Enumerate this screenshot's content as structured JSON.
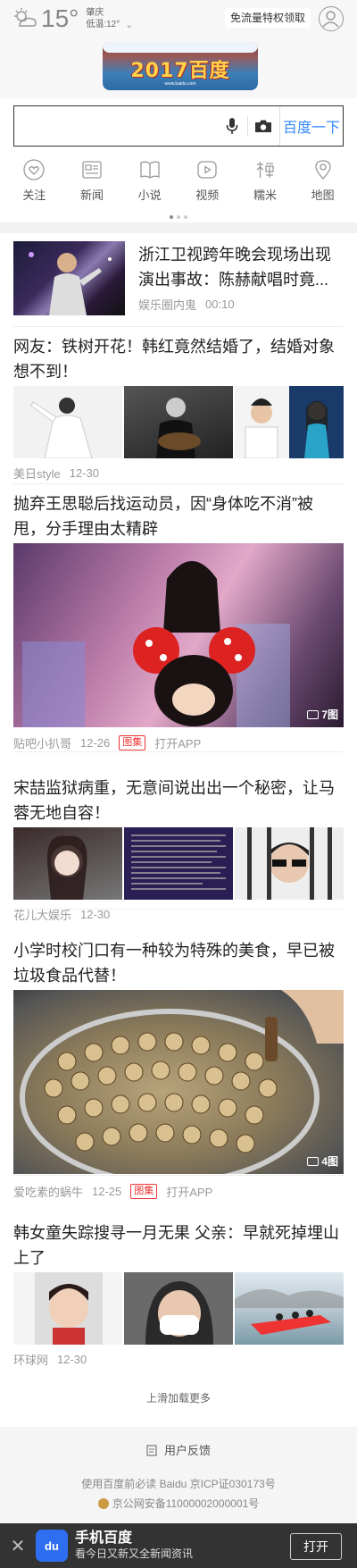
{
  "header": {
    "temperature": "15°",
    "city": "肇庆",
    "low_temp": "低温:12°",
    "promo_label": "免流量特权领取",
    "logo_text": "2017百度",
    "logo_sub": "www.baidu.com"
  },
  "search": {
    "placeholder": "",
    "button_label": "百度一下"
  },
  "nav": [
    {
      "label": "关注",
      "icon": "heart-icon"
    },
    {
      "label": "新闻",
      "icon": "news-icon"
    },
    {
      "label": "小说",
      "icon": "book-icon"
    },
    {
      "label": "视频",
      "icon": "play-icon"
    },
    {
      "label": "糯米",
      "icon": "nuomi-icon"
    },
    {
      "label": "地图",
      "icon": "map-pin-icon"
    }
  ],
  "feed": [
    {
      "title": "浙江卫视跨年晚会现场出现演出事故：陈赫献唱时竟...",
      "source": "娱乐圈内鬼",
      "time": "00:10"
    },
    {
      "title": "网友：铁树开花！韩红竟然结婚了，结婚对象想不到！",
      "source": "美日style",
      "time": "12-30"
    },
    {
      "title": "抛弃王思聪后找运动员，因“身体吃不消”被甩，分手理由太精辟",
      "source": "贴吧小扒哥",
      "time": "12-26",
      "tag": "图集",
      "open_app": "打开APP",
      "image_count": "7图"
    },
    {
      "title": "宋喆监狱病重，无意间说出出一个秘密，让马蓉无地自容！",
      "source": "花儿大娱乐",
      "time": "12-30"
    },
    {
      "title": "小学时校门口有一种较为特殊的美食，早已被垃圾食品代替！",
      "source": "爱吃素的蜗牛",
      "time": "12-25",
      "tag": "图集",
      "open_app": "打开APP",
      "image_count": "4图"
    },
    {
      "title": "韩女童失踪搜寻一月无果 父亲：早就死掉埋山上了",
      "source": "环球网",
      "time": "12-30"
    }
  ],
  "load_more": "上滑加载更多",
  "footer": {
    "feedback": "用户反馈",
    "icp": "使用百度前必读 Baidu 京ICP证030173号",
    "police": "京公网安备11000002000001号"
  },
  "app_banner": {
    "logo": "du",
    "title": "手机百度",
    "subtitle": "看今日又新又全新闻资讯",
    "open_label": "打开"
  },
  "colors": {
    "accent": "#3388ff",
    "tag_red": "#ee3333",
    "bottom_bar": "#333333"
  }
}
